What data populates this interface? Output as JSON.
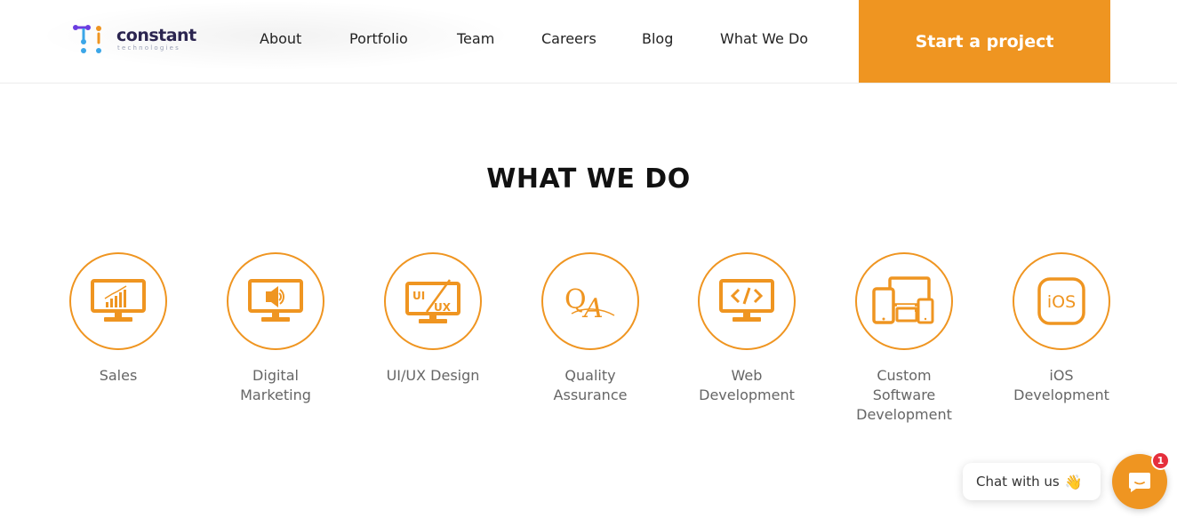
{
  "header": {
    "logo": {
      "word": "constant",
      "sub": "technologies",
      "icon": "constant-logo-icon"
    },
    "nav": [
      {
        "label": "About"
      },
      {
        "label": "Portfolio"
      },
      {
        "label": "Team"
      },
      {
        "label": "Careers"
      },
      {
        "label": "Blog"
      },
      {
        "label": "What We Do"
      }
    ],
    "cta_label": "Start a project"
  },
  "section": {
    "title": "WHAT WE DO",
    "services": [
      {
        "label": "Sales",
        "icon": "sales-chart-monitor-icon"
      },
      {
        "label": "Digital Marketing",
        "icon": "speaker-monitor-icon"
      },
      {
        "label": "UI/UX Design",
        "icon": "ui-ux-monitor-icon"
      },
      {
        "label": "Quality Assurance",
        "icon": "qa-icon"
      },
      {
        "label": "Web Development",
        "icon": "code-monitor-icon"
      },
      {
        "label": "Custom Software Development",
        "icon": "devices-icon"
      },
      {
        "label": "iOS Development",
        "icon": "ios-icon"
      }
    ]
  },
  "chat": {
    "label": "Chat with us",
    "emoji": "👋",
    "badge": "1"
  },
  "colors": {
    "accent": "#ef9521",
    "badge": "#e52f3c",
    "heading": "#111111",
    "muted": "#666666"
  }
}
